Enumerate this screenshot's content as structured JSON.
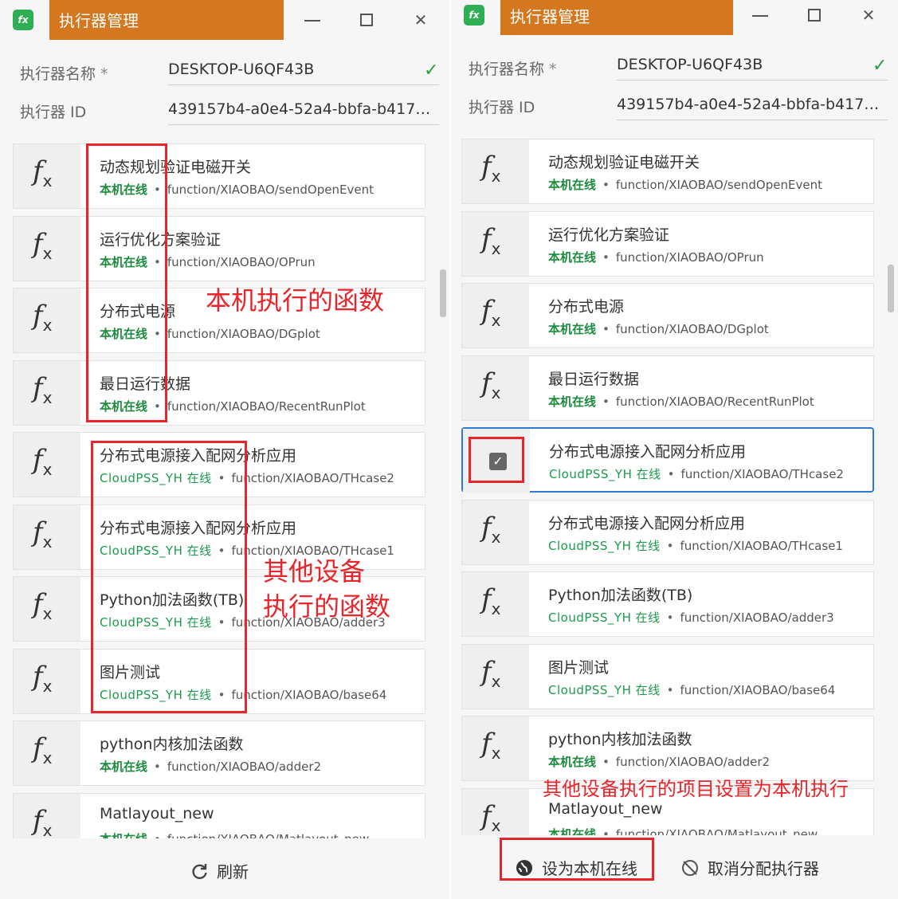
{
  "window": {
    "title": "执行器管理",
    "logo_text": "fx"
  },
  "form": {
    "name_label": "执行器名称",
    "required_mark": "*",
    "name_value": "DESKTOP-U6QF43B",
    "id_label": "执行器 ID",
    "id_value": "439157b4-a0e4-52a4-bbfa-b417…"
  },
  "left_items": [
    {
      "name": "动态规划验证电磁开关",
      "status": "本机在线",
      "path": "function/XIAOBAO/sendOpenEvent",
      "kind": "local"
    },
    {
      "name": "运行优化方案验证",
      "status": "本机在线",
      "path": "function/XIAOBAO/OPrun",
      "kind": "local"
    },
    {
      "name": "分布式电源",
      "status": "本机在线",
      "path": "function/XIAOBAO/DGplot",
      "kind": "local"
    },
    {
      "name": "最日运行数据",
      "status": "本机在线",
      "path": "function/XIAOBAO/RecentRunPlot",
      "kind": "local"
    },
    {
      "name": "分布式电源接入配网分析应用",
      "status": "CloudPSS_YH 在线",
      "path": "function/XIAOBAO/THcase2",
      "kind": "remote"
    },
    {
      "name": "分布式电源接入配网分析应用",
      "status": "CloudPSS_YH 在线",
      "path": "function/XIAOBAO/THcase1",
      "kind": "remote"
    },
    {
      "name": "Python加法函数(TB)",
      "status": "CloudPSS_YH 在线",
      "path": "function/XIAOBAO/adder3",
      "kind": "remote"
    },
    {
      "name": "图片测试",
      "status": "CloudPSS_YH 在线",
      "path": "function/XIAOBAO/base64",
      "kind": "remote"
    },
    {
      "name": "python内核加法函数",
      "status": "本机在线",
      "path": "function/XIAOBAO/adder2",
      "kind": "local"
    },
    {
      "name": "Matlayout_new",
      "status": "本机在线",
      "path": "function/XIAOBAO/Matlayout_new",
      "kind": "local"
    }
  ],
  "right_items": [
    {
      "name": "动态规划验证电磁开关",
      "status": "本机在线",
      "path": "function/XIAOBAO/sendOpenEvent",
      "kind": "local"
    },
    {
      "name": "运行优化方案验证",
      "status": "本机在线",
      "path": "function/XIAOBAO/OPrun",
      "kind": "local"
    },
    {
      "name": "分布式电源",
      "status": "本机在线",
      "path": "function/XIAOBAO/DGplot",
      "kind": "local"
    },
    {
      "name": "最日运行数据",
      "status": "本机在线",
      "path": "function/XIAOBAO/RecentRunPlot",
      "kind": "local"
    },
    {
      "name": "分布式电源接入配网分析应用",
      "status": "CloudPSS_YH 在线",
      "path": "function/XIAOBAO/THcase2",
      "kind": "remote",
      "selected": true
    },
    {
      "name": "分布式电源接入配网分析应用",
      "status": "CloudPSS_YH 在线",
      "path": "function/XIAOBAO/THcase1",
      "kind": "remote"
    },
    {
      "name": "Python加法函数(TB)",
      "status": "CloudPSS_YH 在线",
      "path": "function/XIAOBAO/adder3",
      "kind": "remote"
    },
    {
      "name": "图片测试",
      "status": "CloudPSS_YH 在线",
      "path": "function/XIAOBAO/base64",
      "kind": "remote"
    },
    {
      "name": "python内核加法函数",
      "status": "本机在线",
      "path": "function/XIAOBAO/adder2",
      "kind": "local"
    },
    {
      "name": "Matlayout_new",
      "status": "本机在线",
      "path": "function/XIAOBAO/Matlayout_new",
      "kind": "local"
    }
  ],
  "footer": {
    "refresh_label": "刷新",
    "set_local_label": "设为本机在线",
    "unassign_label": "取消分配执行器"
  },
  "annotations": {
    "local_functions": "本机执行的函数",
    "other_devices_1": "其他设备",
    "other_devices_2": "执行的函数",
    "set_local_note": "其他设备执行的项目设置为本机执行"
  },
  "colors": {
    "accent_title": "#d5771f",
    "status_green": "#1c8b3d",
    "selection_blue": "#2f78d6",
    "annotation_red": "#e8252b"
  },
  "icons": {
    "function": "fx-icon",
    "check": "check-icon",
    "refresh": "refresh-icon",
    "globe": "globe-icon",
    "unassign": "unassign-icon"
  }
}
